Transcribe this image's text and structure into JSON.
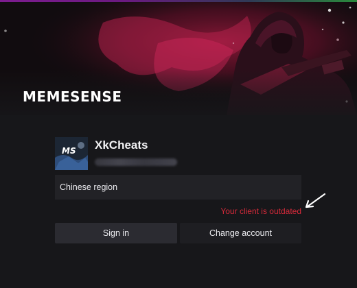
{
  "banner": {
    "brand": "MEMESENSE"
  },
  "profile": {
    "username": "XkCheats",
    "avatar_initials": "MS"
  },
  "region": {
    "value": "Chinese region"
  },
  "status": {
    "message": "Your client is outdated",
    "color": "#d62a3a"
  },
  "actions": {
    "signin_label": "Sign in",
    "change_account_label": "Change account"
  },
  "theme": {
    "accent": "#c0224f",
    "background": "#17171a"
  }
}
